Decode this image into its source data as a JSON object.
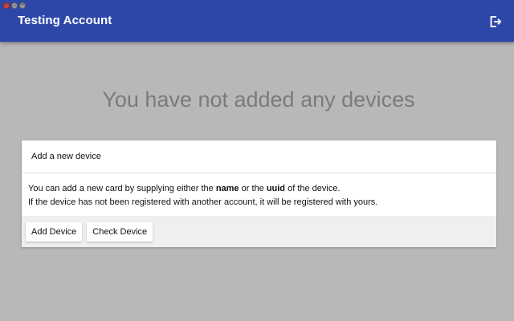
{
  "app": {
    "title": "Testing Account",
    "accent_color": "#2c47a8",
    "logout_icon": "logout-icon"
  },
  "main": {
    "empty_message": "You have not added any devices"
  },
  "add_device_card": {
    "header": "Add a new device",
    "body_line1_prefix": "You can add a new card by supplying either the ",
    "body_line1_name": "name",
    "body_line1_middle": " or the ",
    "body_line1_uuid": "uuid",
    "body_line1_suffix": " of the device.",
    "body_line2": "If the device has not been registered with another account, it will be registered with yours.",
    "add_button_label": "Add Device",
    "check_button_label": "Check Device"
  }
}
